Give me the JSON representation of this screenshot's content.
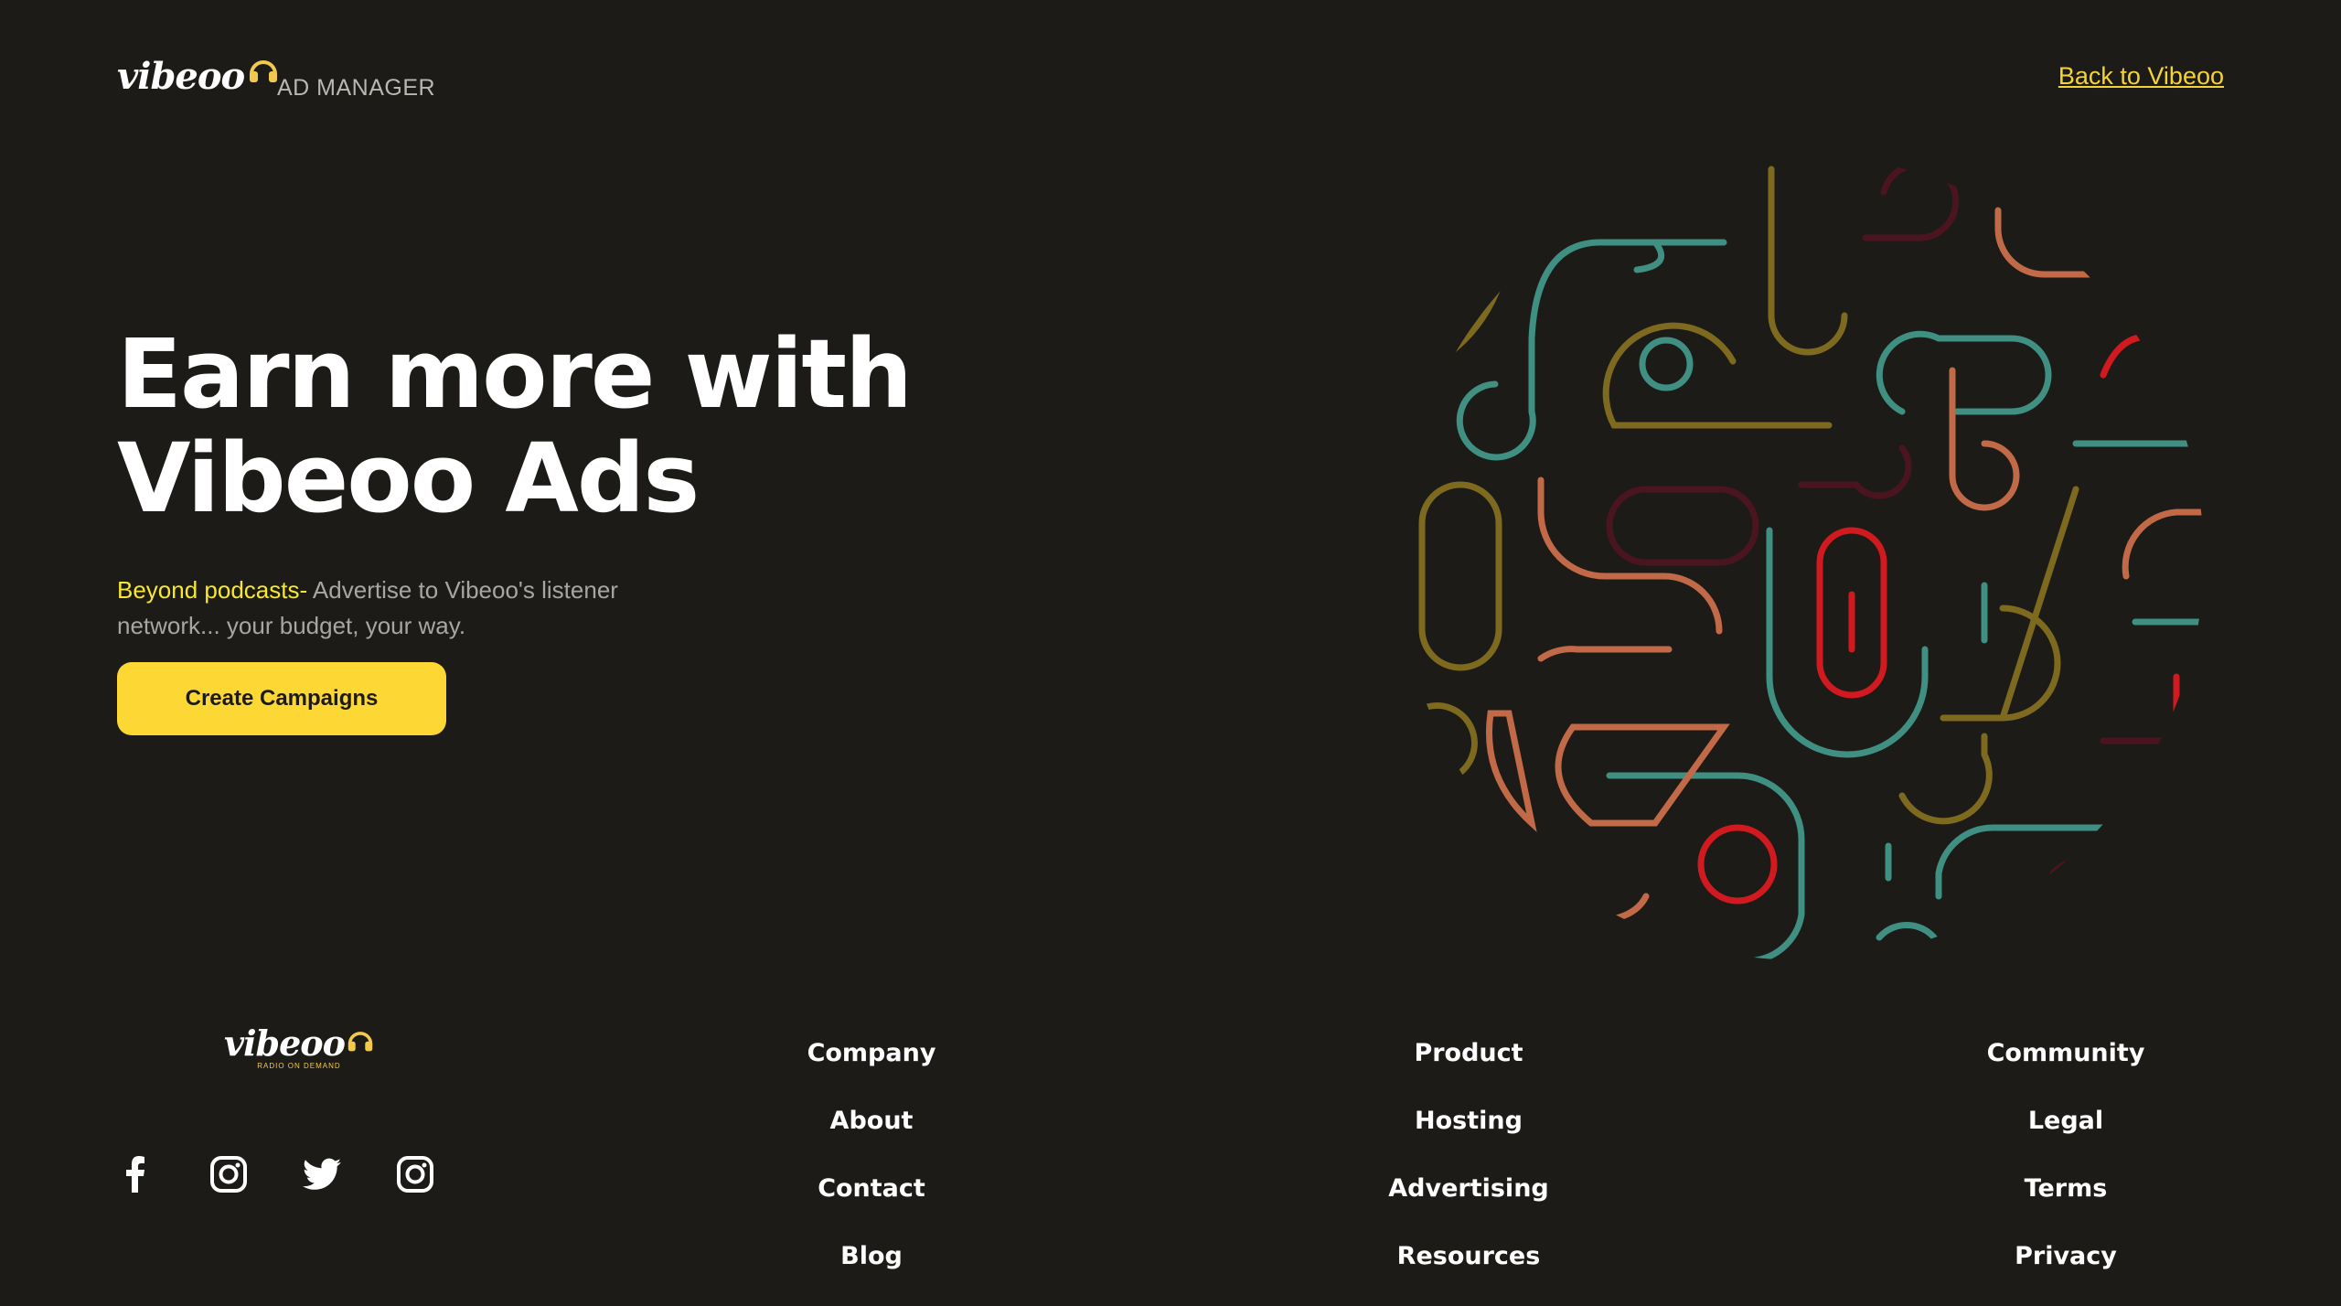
{
  "header": {
    "logo_text": "vibeoo",
    "subtitle": "AD MANAGER",
    "back_link": "Back to Vibeoo"
  },
  "hero": {
    "title_line1": "Earn more with",
    "title_line2": "Vibeoo Ads",
    "desc_accent": "Beyond podcasts-",
    "desc_rest": " Advertise to Vibeoo's listener network... your budget, your way.",
    "cta_label": "Create Campaigns"
  },
  "footer": {
    "logo_text": "vibeoo",
    "logo_tagline": "RADIO ON DEMAND",
    "socials": [
      "facebook-icon",
      "instagram-icon",
      "twitter-icon",
      "instagram-icon"
    ],
    "columns": [
      {
        "title": "Company",
        "links": [
          "About",
          "Contact",
          "Blog"
        ]
      },
      {
        "title": "Product",
        "links": [
          "Hosting",
          "Advertising",
          "Resources"
        ]
      },
      {
        "title": "Community",
        "links": [
          "Legal",
          "Terms",
          "Privacy"
        ]
      }
    ]
  },
  "colors": {
    "background": "#1d1b18",
    "accent_yellow": "#fdd835",
    "link_yellow": "#f4d23a",
    "art_teal": "#3f8f82",
    "art_olive": "#7d6a1f",
    "art_orange": "#c26a47",
    "art_red": "#d11a1f",
    "art_maroon": "#4b1520"
  }
}
